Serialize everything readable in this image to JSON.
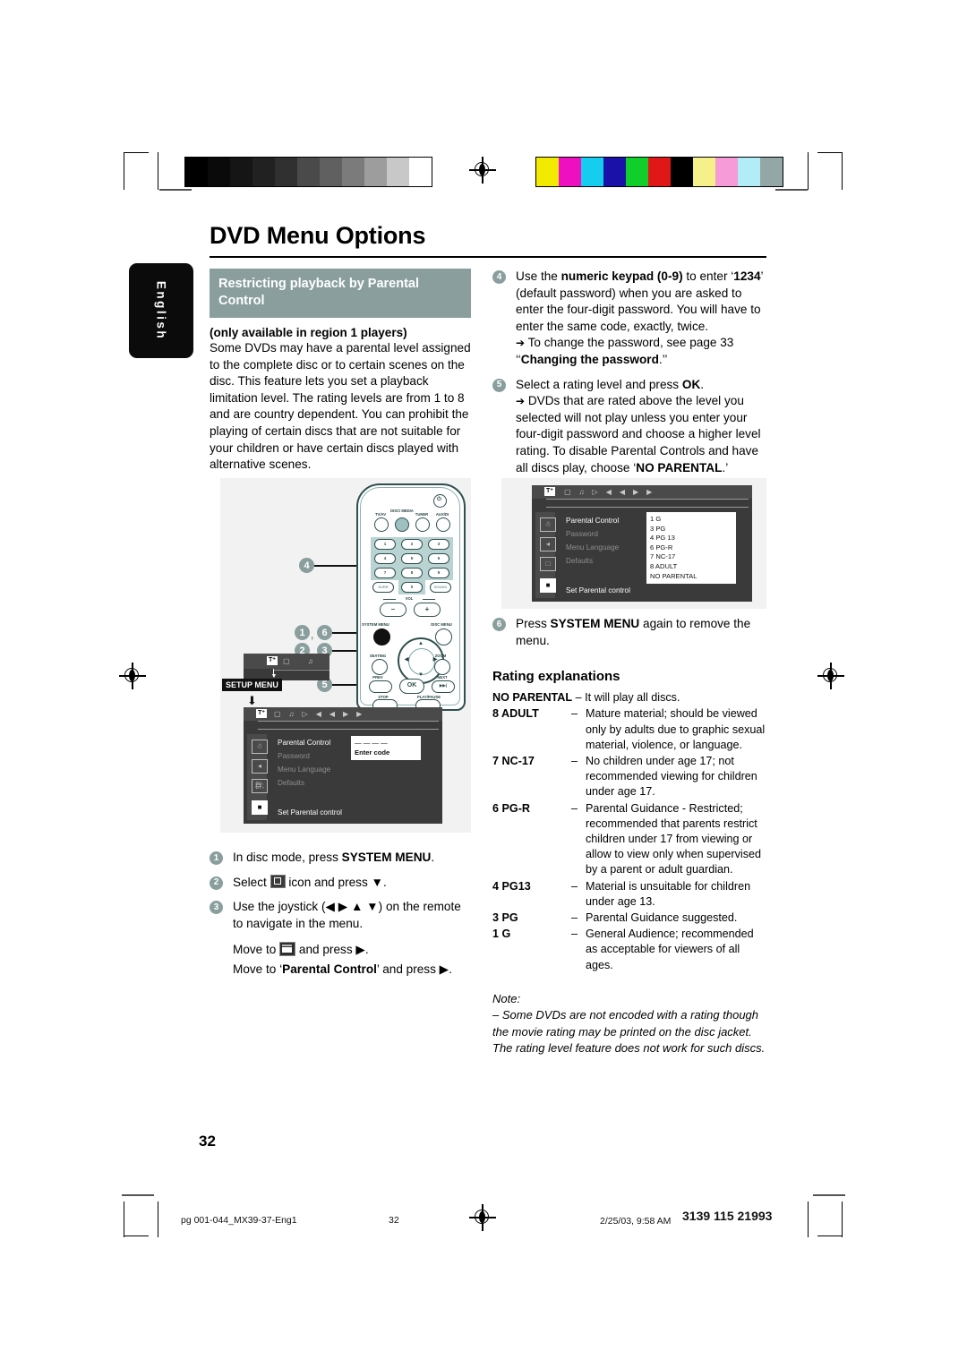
{
  "page": {
    "title": "DVD Menu Options",
    "language_tab": "English",
    "page_number": "32"
  },
  "left_column": {
    "section_heading": "Restricting playback by Parental Control",
    "lead": "(only available in region 1 players)",
    "paragraph": "Some DVDs may have a parental level assigned to the complete disc or to certain scenes on the disc. This feature lets you set a playback limitation level. The rating levels are from 1 to 8 and are country dependent. You can prohibit the playing of certain discs that are not suitable for your children or have certain discs played with alternative scenes.",
    "steps": [
      {
        "num": "1",
        "text_before": "In disc mode, press ",
        "bold": "SYSTEM MENU",
        "text_after": "."
      },
      {
        "num": "2",
        "text_before": "Select ",
        "icon": "setup-menu-icon",
        "text_after": " icon and press ▼."
      },
      {
        "num": "3",
        "text_before": "Use the joystick (◀ ▶ ▲ ▼) on the remote to navigate in the menu."
      }
    ],
    "substeps": [
      {
        "before": "Move to ",
        "icon": "preferences-icon",
        "after": " and press ▶."
      },
      {
        "before": "Move to ‘",
        "bold": "Parental Control",
        "after": "’ and press ▶."
      }
    ]
  },
  "right_column": {
    "steps": [
      {
        "num": "4",
        "line1_a": "Use the ",
        "line1_b": "numeric keypad (0-9)",
        "line1_c": " to enter ‘",
        "line1_d": "1234",
        "line1_e": "’ (default password) when you are asked to enter the four-digit password. You will have to enter the same code, exactly, twice.",
        "arrow_a": "To change the password, see page 33 ‘‘",
        "arrow_b": "Changing the password",
        "arrow_c": ".’’"
      },
      {
        "num": "5",
        "line1_a": "Select a rating level and press ",
        "line1_b": "OK",
        "line1_c": ".",
        "arrow_a": "DVDs that are rated above the level you selected will not play unless you enter your four-digit password and choose a higher level rating. To disable Parental Controls and have all discs play, choose ‘",
        "arrow_b": "NO PARENTAL",
        "arrow_c": ".’"
      },
      {
        "num": "6",
        "line1_a": "Press ",
        "line1_b": "SYSTEM MENU",
        "line1_c": " again to remove the menu."
      }
    ],
    "ratings_heading": "Rating explanations",
    "no_parental_key": "NO PARENTAL",
    "no_parental_value": "– It will play all discs.",
    "ratings": [
      {
        "key": "8 ADULT",
        "dash": "–",
        "value": "Mature material; should be viewed only by adults due to graphic sexual material, violence, or language."
      },
      {
        "key": "7 NC-17",
        "dash": "–",
        "value": "No children under age 17; not recommended viewing for children under age 17."
      },
      {
        "key": "6 PG-R",
        "dash": "–",
        "value": "Parental Guidance - Restricted; recommended that parents restrict children under 17 from viewing or allow to view only when supervised by a parent or adult guardian."
      },
      {
        "key": "4 PG13",
        "dash": "–",
        "value": "Material is unsuitable for children under age 13."
      },
      {
        "key": "3 PG",
        "dash": "–",
        "value": "Parental Guidance suggested."
      },
      {
        "key": "1 G",
        "dash": "–",
        "value": "General Audience; recommended as acceptable for viewers of all ages."
      }
    ],
    "note_label": "Note:",
    "note_text": "–  Some DVDs are not encoded with a rating though the movie rating may be printed on the disc jacket. The rating level feature does not work for such discs."
  },
  "figures": {
    "remote": {
      "callouts": [
        "4",
        "1",
        "6",
        "2",
        "3",
        "5"
      ],
      "top_buttons": [
        "TV/AV",
        "DISC/ MEDIA",
        "TUNER",
        "AUX/DI"
      ],
      "keypad": [
        "1",
        "2",
        "3",
        "4",
        "5",
        "6",
        "7",
        "8",
        "9",
        "0"
      ],
      "side_left": "SURR",
      "side_right": "SOUND",
      "vol_label": "VOL",
      "vol_minus": "–",
      "vol_plus": "+",
      "system_menu_label": "SYSTEM MENU",
      "disc_menu_label": "DISC MENU",
      "seating_label": "SEATING",
      "zoom_label": "ZOOM",
      "prev_label": "PREV",
      "next_label": "NEXT",
      "ok_label": "OK",
      "stop_label": "STOP",
      "play_label": "PLAY/PAUSE"
    },
    "osd_small": {
      "setup_menu_label": "SETUP MENU"
    },
    "osd_entercode": {
      "menu_items": [
        "Parental Control",
        "Password",
        "Menu Language",
        "Defaults"
      ],
      "status": "Set Parental control",
      "popup_dashes": "— — — —",
      "popup_label": "Enter code"
    },
    "osd_ratings": {
      "menu_items": [
        "Parental Control",
        "Password",
        "Menu Language",
        "Defaults"
      ],
      "status": "Set Parental control",
      "options": [
        "1 G",
        "3 PG",
        "4 PG 13",
        "6 PG-R",
        "7 NC-17",
        "8 ADULT",
        "NO PARENTAL"
      ]
    }
  },
  "footer": {
    "file": "pg 001-044_MX39-37-Eng1",
    "page": "32",
    "timestamp": "2/25/03, 9:58 AM",
    "code": "3139 115 21993"
  },
  "colors": {
    "accent": "#8a9e9e",
    "heading_band": "#8a9e9e",
    "tab": "#0b0b0b",
    "osd": "#3a3a3a"
  }
}
